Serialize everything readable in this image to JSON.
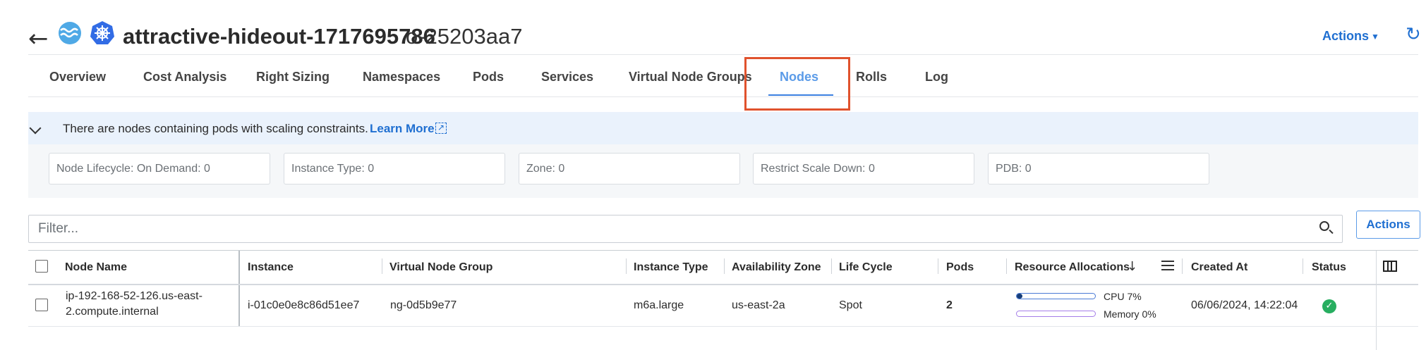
{
  "header": {
    "back_icon": "back-arrow-icon",
    "title": "attractive-hideout-1717695786",
    "cluster_id": "o-25203aa7",
    "actions_label": "Actions",
    "refresh_icon": "refresh-icon"
  },
  "tabs": [
    {
      "label": "Overview"
    },
    {
      "label": "Cost Analysis"
    },
    {
      "label": "Right Sizing"
    },
    {
      "label": "Namespaces"
    },
    {
      "label": "Pods"
    },
    {
      "label": "Services"
    },
    {
      "label": "Virtual Node Groups"
    },
    {
      "label": "Nodes",
      "active": true
    },
    {
      "label": "Rolls"
    },
    {
      "label": "Log"
    }
  ],
  "banner": {
    "text": "There are nodes containing pods with scaling constraints.",
    "learn_more": "Learn More"
  },
  "filters": [
    {
      "label": "Node Lifecycle: On Demand: 0"
    },
    {
      "label": "Instance Type: 0"
    },
    {
      "label": "Zone: 0"
    },
    {
      "label": "Restrict Scale Down: 0"
    },
    {
      "label": "PDB: 0"
    }
  ],
  "search": {
    "placeholder": "Filter..."
  },
  "table": {
    "actions_label": "Actions",
    "columns": [
      "Node Name",
      "Instance",
      "Virtual Node Group",
      "Instance Type",
      "Availability Zone",
      "Life Cycle",
      "Pods",
      "Resource Allocations",
      "Created At",
      "Status"
    ],
    "rows": [
      {
        "node_name_line1": "ip-192-168-52-126.us-east-",
        "node_name_line2": "2.compute.internal",
        "instance": "i-01c0e0e8c86d51ee7",
        "virtual_node_group": "ng-0d5b9e77",
        "instance_type": "m6a.large",
        "availability_zone": "us-east-2a",
        "life_cycle": "Spot",
        "pods": "2",
        "cpu_label": "CPU 7%",
        "cpu_percent": 7,
        "memory_label": "Memory 0%",
        "memory_percent": 0,
        "created_at": "06/06/2024, 14:22:04",
        "status": "ok"
      }
    ]
  },
  "colors": {
    "accent": "#1f6fd1",
    "active_tab": "#5b9be8",
    "highlight": "#e0522d",
    "status_ok": "#27ae60"
  }
}
